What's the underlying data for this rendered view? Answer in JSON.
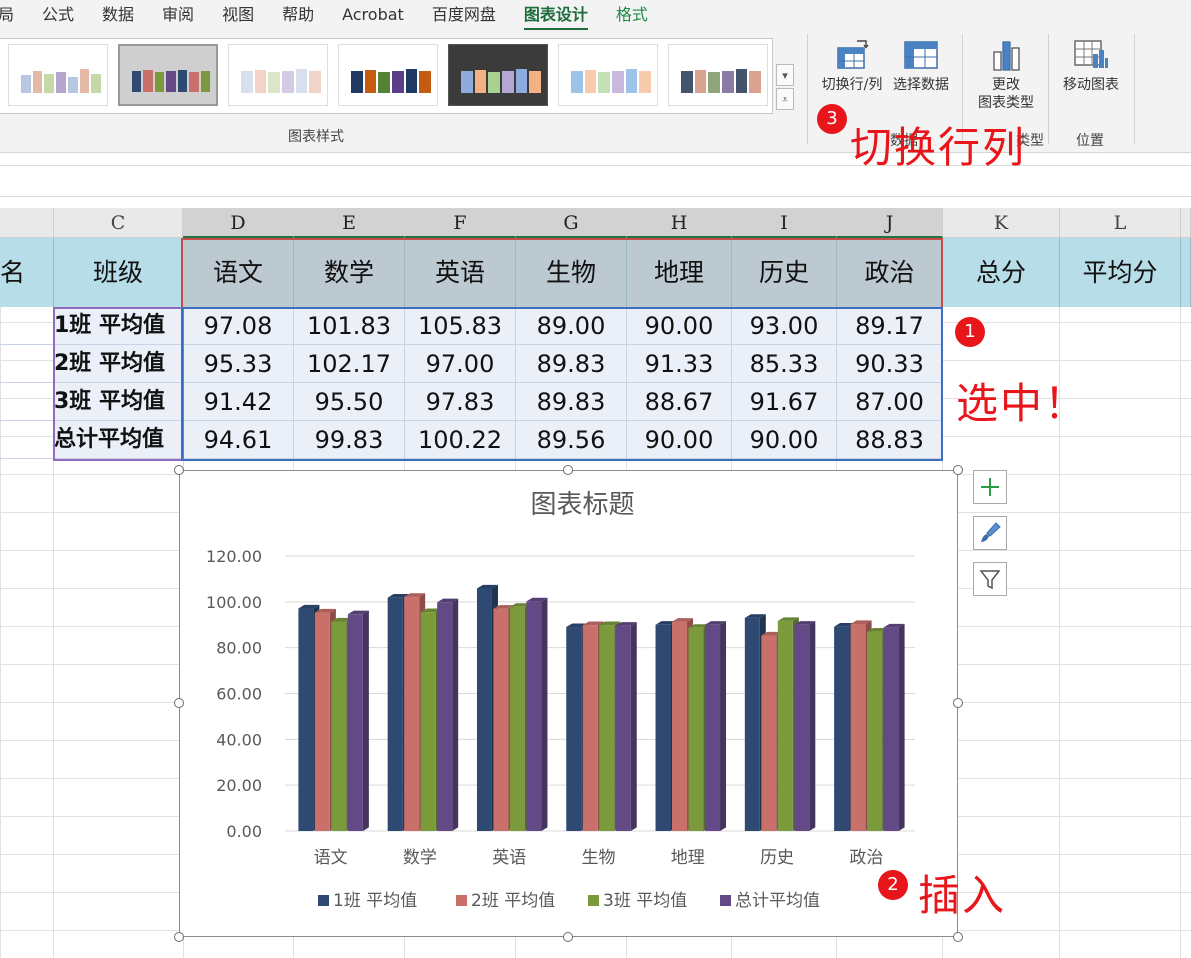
{
  "ribbon": {
    "tabs": [
      "局",
      "公式",
      "数据",
      "审阅",
      "视图",
      "帮助",
      "Acrobat",
      "百度网盘",
      "图表设计",
      "格式"
    ],
    "active_tab": "图表设计",
    "chart_styles_label": "图表样式",
    "switch_row_col_label": "切换行/列",
    "select_data_label": "选择数据",
    "change_type_label": "更改\n图表类型",
    "change_type_line1": "更改",
    "change_type_line2": "图表类型",
    "type_group_label": "类型",
    "data_group_label_partial": "数据",
    "move_chart_label": "移动图表",
    "location_group_label": "位置"
  },
  "sheet": {
    "column_headers": [
      "C",
      "D",
      "E",
      "F",
      "G",
      "H",
      "I",
      "J",
      "K",
      "L"
    ],
    "cut_header_text": "名",
    "header_row": [
      "班级",
      "语文",
      "数学",
      "英语",
      "生物",
      "地理",
      "历史",
      "政治",
      "总分",
      "平均分"
    ],
    "rows": [
      {
        "label": "1班 平均值",
        "values": [
          "97.08",
          "101.83",
          "105.83",
          "89.00",
          "90.00",
          "93.00",
          "89.17"
        ]
      },
      {
        "label": "2班 平均值",
        "values": [
          "95.33",
          "102.17",
          "97.00",
          "89.83",
          "91.33",
          "85.33",
          "90.33"
        ]
      },
      {
        "label": "3班 平均值",
        "values": [
          "91.42",
          "95.50",
          "97.83",
          "89.83",
          "88.67",
          "91.67",
          "87.00"
        ]
      },
      {
        "label": "总计平均值",
        "values": [
          "94.61",
          "99.83",
          "100.22",
          "89.56",
          "90.00",
          "90.00",
          "88.83"
        ]
      }
    ]
  },
  "chart_data": {
    "type": "bar",
    "title": "图表标题",
    "categories": [
      "语文",
      "数学",
      "英语",
      "生物",
      "地理",
      "历史",
      "政治"
    ],
    "series": [
      {
        "name": "1班 平均值",
        "color": "#2e4a73",
        "values": [
          97.08,
          101.83,
          105.83,
          89.0,
          90.0,
          93.0,
          89.17
        ]
      },
      {
        "name": "2班 平均值",
        "color": "#c9706b",
        "values": [
          95.33,
          102.17,
          97.0,
          89.83,
          91.33,
          85.33,
          90.33
        ]
      },
      {
        "name": "3班 平均值",
        "color": "#7a9a3c",
        "values": [
          91.42,
          95.5,
          97.83,
          89.83,
          88.67,
          91.67,
          87.0
        ]
      },
      {
        "name": "总计平均值",
        "color": "#634a86",
        "values": [
          94.61,
          99.83,
          100.22,
          89.56,
          90.0,
          90.0,
          88.83
        ]
      }
    ],
    "yticks": [
      "0.00",
      "20.00",
      "40.00",
      "60.00",
      "80.00",
      "100.00",
      "120.00"
    ],
    "ylim": [
      0,
      120
    ],
    "grid": true,
    "legend": "bottom",
    "xlabel": "",
    "ylabel": ""
  },
  "annotations": {
    "step1_number": "1",
    "step1_text": "选中！",
    "step2_number": "2",
    "step2_text": "插入",
    "step3_number": "3",
    "step3_text": "切换行列"
  },
  "colors": {
    "accent": "#217346",
    "annotation": "#e8151b",
    "header_cyan": "#b7dde8",
    "header_grey": "#bcc9d1"
  }
}
